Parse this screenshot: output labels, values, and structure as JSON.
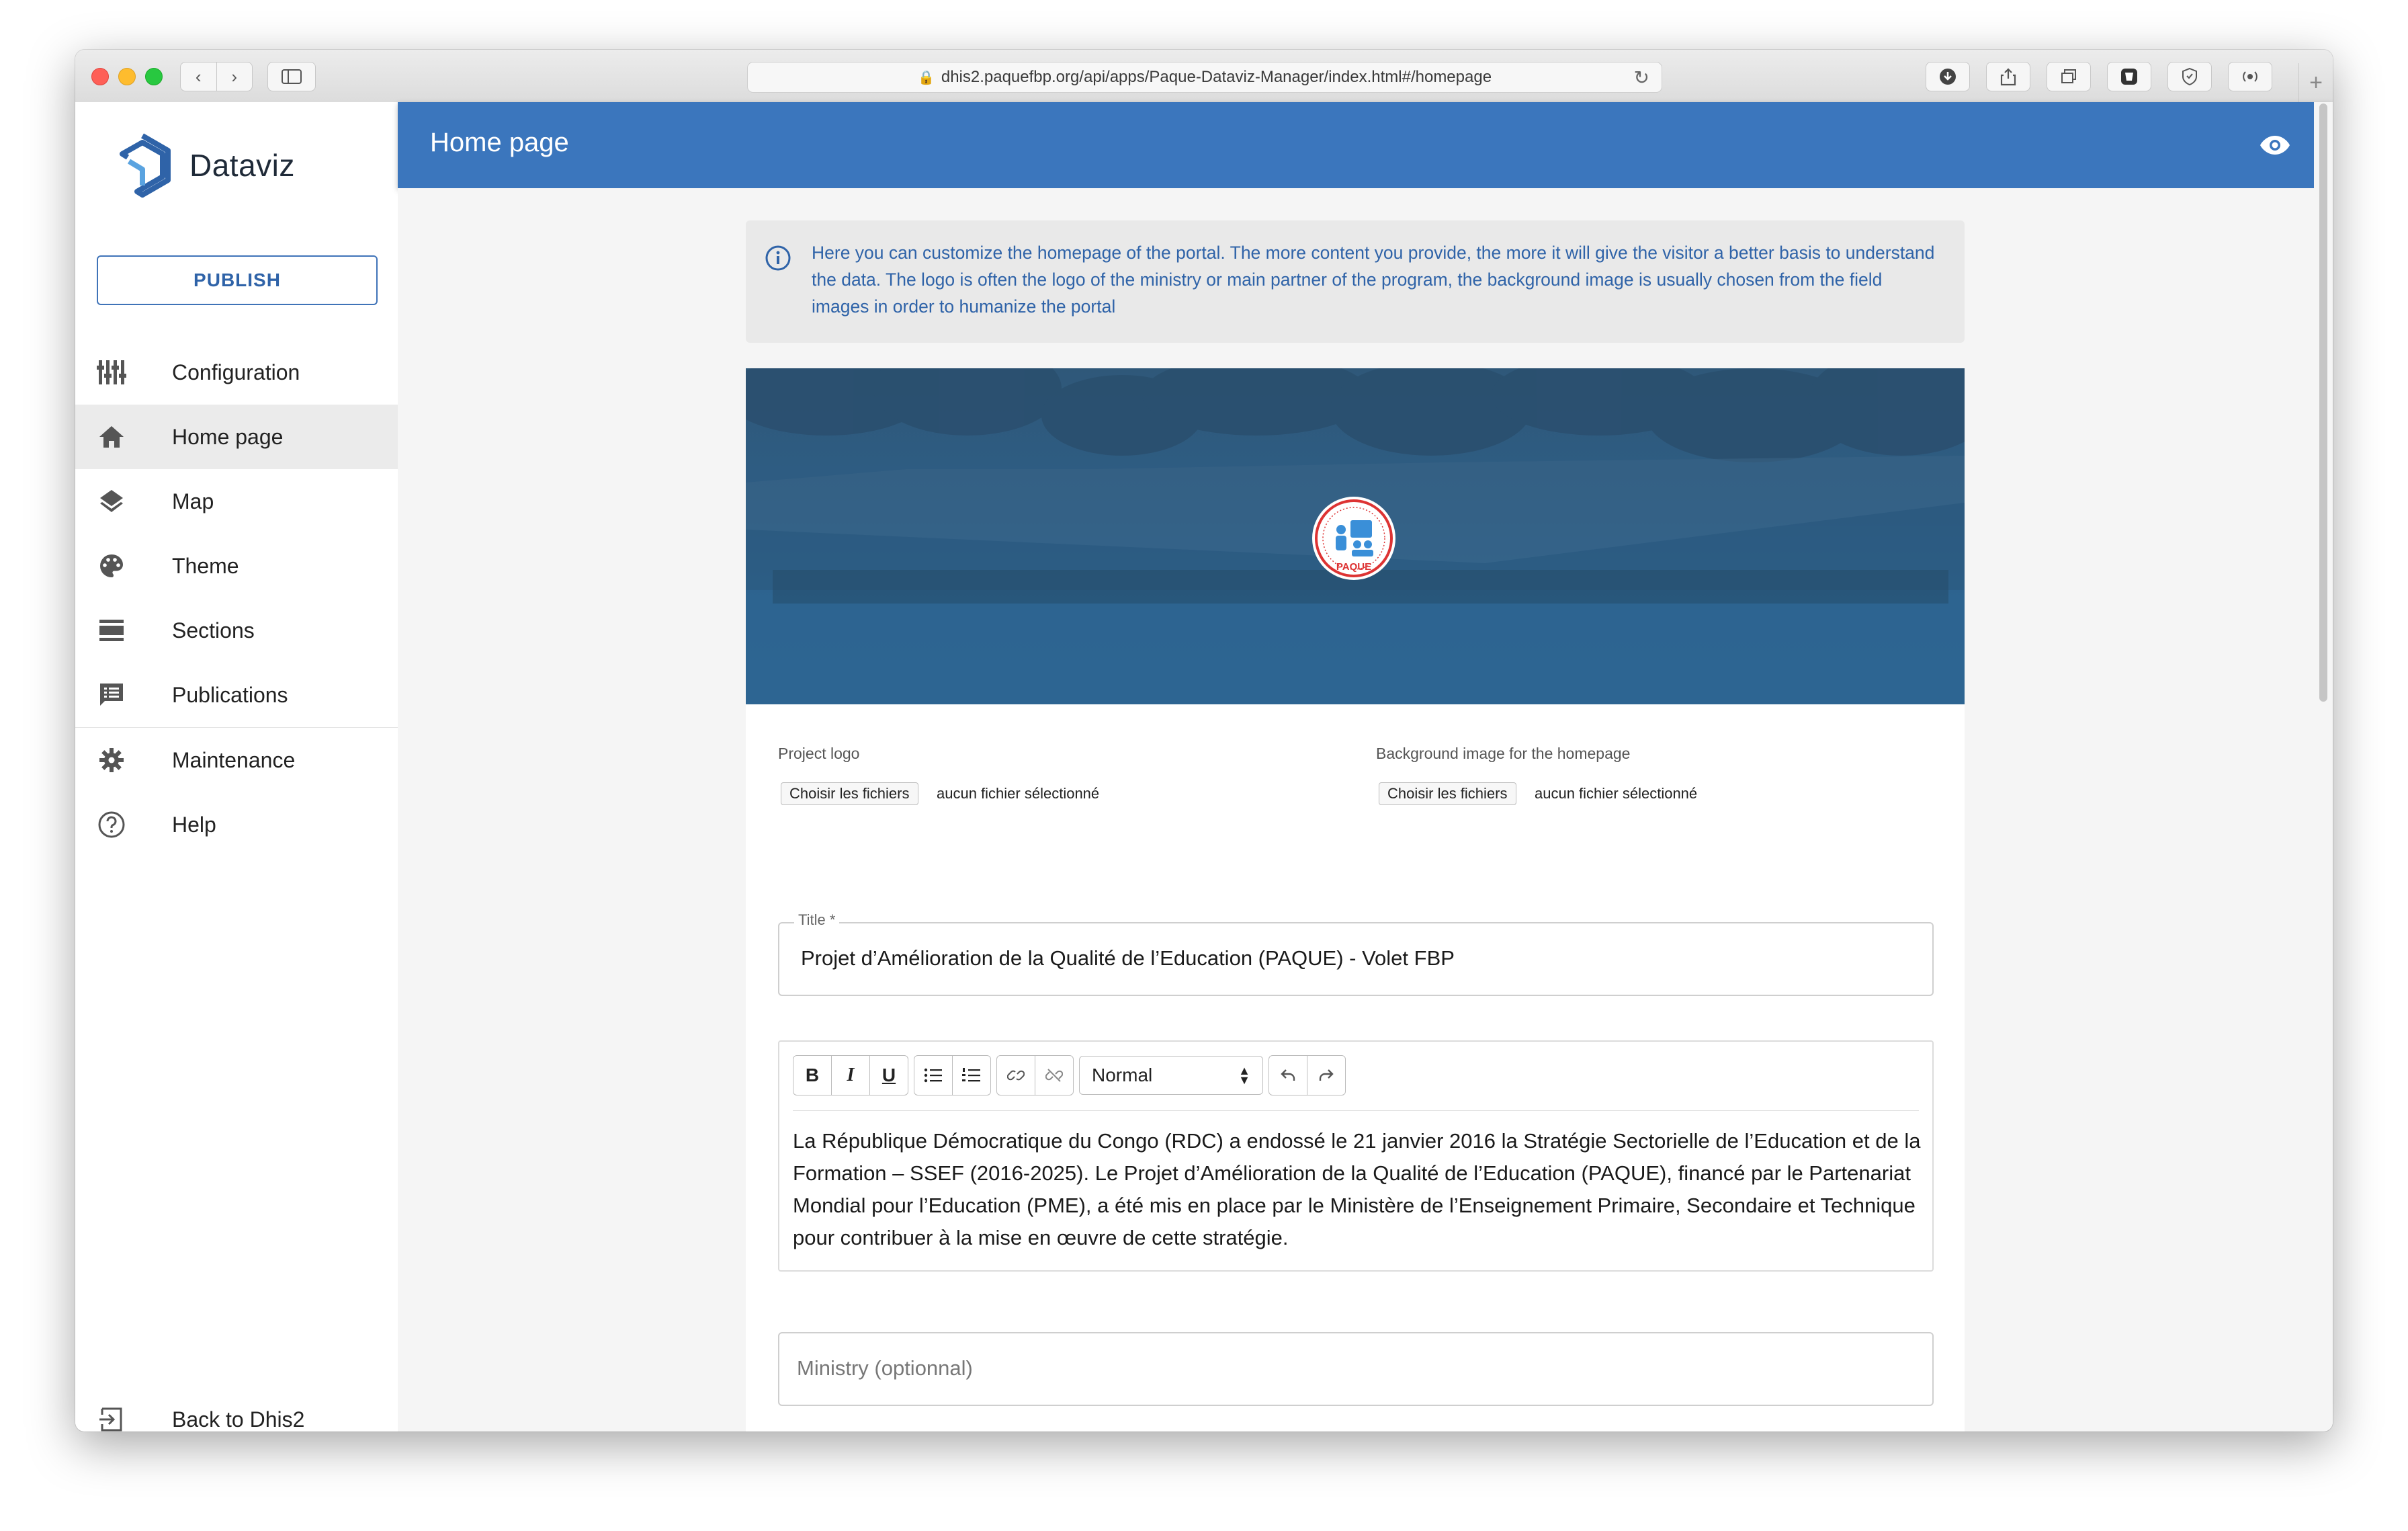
{
  "browser": {
    "url": "dhis2.paquefbp.org/api/apps/Paque-Dataviz-Manager/index.html#/homepage"
  },
  "sidebar": {
    "brand": "Dataviz",
    "publish_label": "PUBLISH",
    "items": [
      {
        "label": "Configuration",
        "icon": "tune-icon"
      },
      {
        "label": "Home page",
        "icon": "home-icon",
        "active": true
      },
      {
        "label": "Map",
        "icon": "layers-icon"
      },
      {
        "label": "Theme",
        "icon": "palette-icon"
      },
      {
        "label": "Sections",
        "icon": "sections-icon"
      },
      {
        "label": "Publications",
        "icon": "publications-icon"
      },
      {
        "label": "Maintenance",
        "icon": "gear-icon"
      },
      {
        "label": "Help",
        "icon": "help-icon"
      }
    ],
    "back_label": "Back to Dhis2"
  },
  "header": {
    "title": "Home page",
    "preview_icon": "eye-icon"
  },
  "info": {
    "text": "Here you can customize the homepage of the portal. The more content you provide, the more it will give the visitor a better basis to understand the data. The logo is often the logo of the ministry or main partner of the program, the background image is usually chosen from the field images in order to humanize the portal"
  },
  "banner": {
    "logo_text": "PAQUE"
  },
  "uploads": {
    "logo_label": "Project logo",
    "background_label": "Background image for the homepage",
    "choose_button": "Choisir les fichiers",
    "no_file": "aucun fichier sélectionné"
  },
  "form": {
    "title_label": "Title *",
    "title_value": "Projet d’Amélioration de la Qualité de l’Education (PAQUE) - Volet  FBP",
    "editor_format": "Normal",
    "editor_text": " La République Démocratique du Congo (RDC) a endossé le 21 janvier 2016 la Stratégie Sectorielle de l’Education et de la Formation – SSEF (2016-2025). Le Projet d’Amélioration de la Qualité de l’Education (PAQUE), financé par le Partenariat Mondial pour l’Education (PME), a été mis en place par le Ministère de l’Enseignement Primaire, Secondaire et Technique pour contribuer à la mise en œuvre de cette stratégie.",
    "ministry_placeholder": "Ministry (optionnal)"
  },
  "colors": {
    "accent": "#3b76bd",
    "info_text": "#2f63a8"
  }
}
